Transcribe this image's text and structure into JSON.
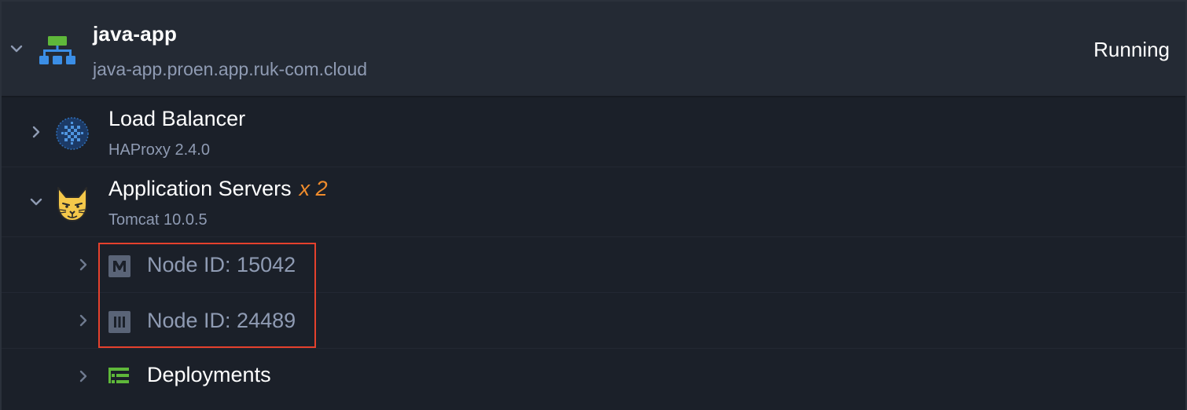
{
  "environment": {
    "name": "java-app",
    "domain": "java-app.proen.app.ruk-com.cloud",
    "status": "Running",
    "icon": "environment-topology-icon"
  },
  "node_groups": [
    {
      "title": "Load Balancer",
      "subtitle": "HAProxy 2.4.0",
      "icon": "haproxy-icon",
      "expanded": false
    },
    {
      "title": "Application Servers",
      "count": "x 2",
      "subtitle": "Tomcat 10.0.5",
      "icon": "tomcat-icon",
      "expanded": true,
      "children": [
        {
          "label": "Node ID: 15042",
          "icon": "master-node-icon"
        },
        {
          "label": "Node ID: 24489",
          "icon": "node-icon"
        },
        {
          "label": "Deployments",
          "icon": "deployments-icon"
        }
      ]
    }
  ],
  "colors": {
    "background": "#1b2029",
    "header_background": "#242a34",
    "muted_text": "#8f9bb3",
    "accent_count": "#f08c2c",
    "highlight_border": "#e5412d",
    "deployments_icon": "#5fb83a",
    "env_icon_green": "#5fb83a",
    "env_icon_blue": "#3b8ee6"
  }
}
